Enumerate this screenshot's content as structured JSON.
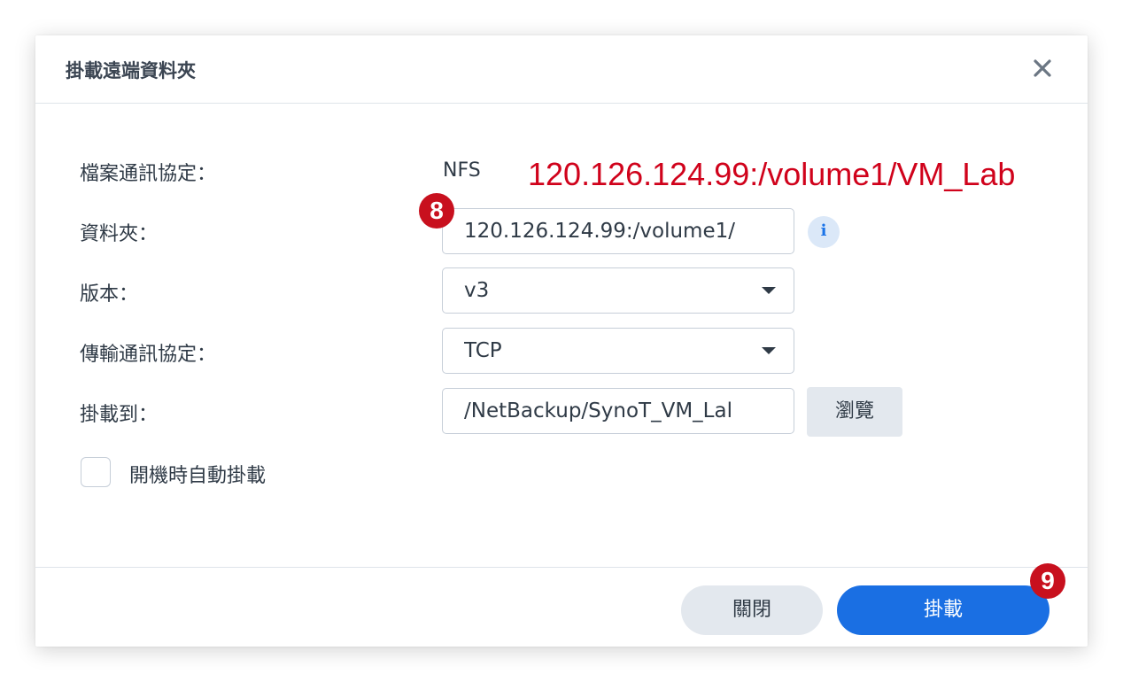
{
  "dialog": {
    "title": "掛載遠端資料夾"
  },
  "form": {
    "protocol_label": "檔案通訊協定：",
    "protocol_value": "NFS",
    "folder_label": "資料夾：",
    "folder_value": "120.126.124.99:/volume1/",
    "version_label": "版本：",
    "version_value": "v3",
    "transport_label": "傳輸通訊協定：",
    "transport_value": "TCP",
    "mount_to_label": "掛載到：",
    "mount_to_value": "/NetBackup/SynoT_VM_Lal",
    "browse_label": "瀏覽",
    "automount_label": "開機時自動掛載",
    "automount_checked": false
  },
  "footer": {
    "close_label": "關閉",
    "mount_label": "掛載"
  },
  "annotations": {
    "folder_path": "120.126.124.99:/volume1/VM_Lab",
    "step_folder": "8",
    "step_mount": "9",
    "color": "#d0021b"
  },
  "colors": {
    "primary": "#1a6fe3",
    "secondary_button": "#e3e8ee",
    "badge": "#c8101e"
  },
  "icons": {
    "close": "close-icon",
    "info": "info-icon",
    "dropdown": "caret-down-icon"
  }
}
